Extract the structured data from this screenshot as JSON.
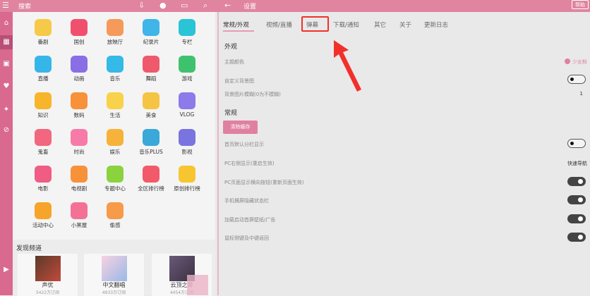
{
  "topbar": {
    "search_label": "搜索",
    "settings_label": "设置",
    "help_label": "帮助"
  },
  "categories": [
    {
      "label": "番剧",
      "color": "#f7c948"
    },
    {
      "label": "国创",
      "color": "#f0506e"
    },
    {
      "label": "放映厅",
      "color": "#f59a5a"
    },
    {
      "label": "纪录片",
      "color": "#3fb5e8"
    },
    {
      "label": "专栏",
      "color": "#29c4d6"
    },
    {
      "label": "直播",
      "color": "#36b6e8"
    },
    {
      "label": "动画",
      "color": "#8a6ee6"
    },
    {
      "label": "音乐",
      "color": "#35b9e6"
    },
    {
      "label": "舞蹈",
      "color": "#ee5a6c"
    },
    {
      "label": "游戏",
      "color": "#3fc26e"
    },
    {
      "label": "知识",
      "color": "#f7b52c"
    },
    {
      "label": "数码",
      "color": "#f7913a"
    },
    {
      "label": "生活",
      "color": "#f8d24a"
    },
    {
      "label": "美食",
      "color": "#f6c445"
    },
    {
      "label": "VLOG",
      "color": "#8c7be8"
    },
    {
      "label": "鬼畜",
      "color": "#f2667f"
    },
    {
      "label": "时尚",
      "color": "#f77ba6"
    },
    {
      "label": "娱乐",
      "color": "#f7b23a"
    },
    {
      "label": "音乐PLUS",
      "color": "#3aa8d8"
    },
    {
      "label": "影视",
      "color": "#7a74e0"
    },
    {
      "label": "电影",
      "color": "#f05c84"
    },
    {
      "label": "电视剧",
      "color": "#f7913a"
    },
    {
      "label": "专题中心",
      "color": "#8bd23f"
    },
    {
      "label": "全区排行榜",
      "color": "#f25a6a"
    },
    {
      "label": "原创排行榜",
      "color": "#f7c530"
    },
    {
      "label": "活动中心",
      "color": "#f7a42a"
    },
    {
      "label": "小黑屋",
      "color": "#f47196"
    },
    {
      "label": "偷感",
      "color": "#f79a4a"
    }
  ],
  "discover": {
    "title": "发现频道",
    "cards": [
      {
        "name": "声优",
        "count": "5422万订阅"
      },
      {
        "name": "中文翻唱",
        "count": "4933万订阅"
      },
      {
        "name": "云顶之弈",
        "count": "4454万订阅"
      }
    ]
  },
  "settings": {
    "tabs": [
      "常规/外观",
      "视频/直播",
      "弹幕",
      "下载/通知",
      "其它",
      "关于",
      "更新日志"
    ],
    "appearance_title": "外观",
    "theme_label": "主题颜色",
    "theme_value": "少女粉",
    "theme_color": "#e07f9f",
    "custom_bg_label": "自定义背景图",
    "blur_label": "背景图片模糊(0为不模糊)",
    "blur_value": "1",
    "general_title": "常规",
    "clear_cache_label": "清除缓存",
    "rows": [
      {
        "label": "首页默认分栏显示",
        "type": "toggle",
        "on": false
      },
      {
        "label": "PC右侧显示(重启生效)",
        "type": "value",
        "value": "快速导航"
      },
      {
        "label": "PC页面显示横向按钮(重新页面生效)",
        "type": "toggle",
        "on": true
      },
      {
        "label": "手机横屏隐藏状态栏",
        "type": "toggle",
        "on": true
      },
      {
        "label": "加载启动首屏壁纸/广告",
        "type": "toggle",
        "on": true
      },
      {
        "label": "鼠标侧键及中键返回",
        "type": "toggle",
        "on": true
      }
    ]
  },
  "accent": "#e0849f",
  "annotation_color": "#f2302a"
}
